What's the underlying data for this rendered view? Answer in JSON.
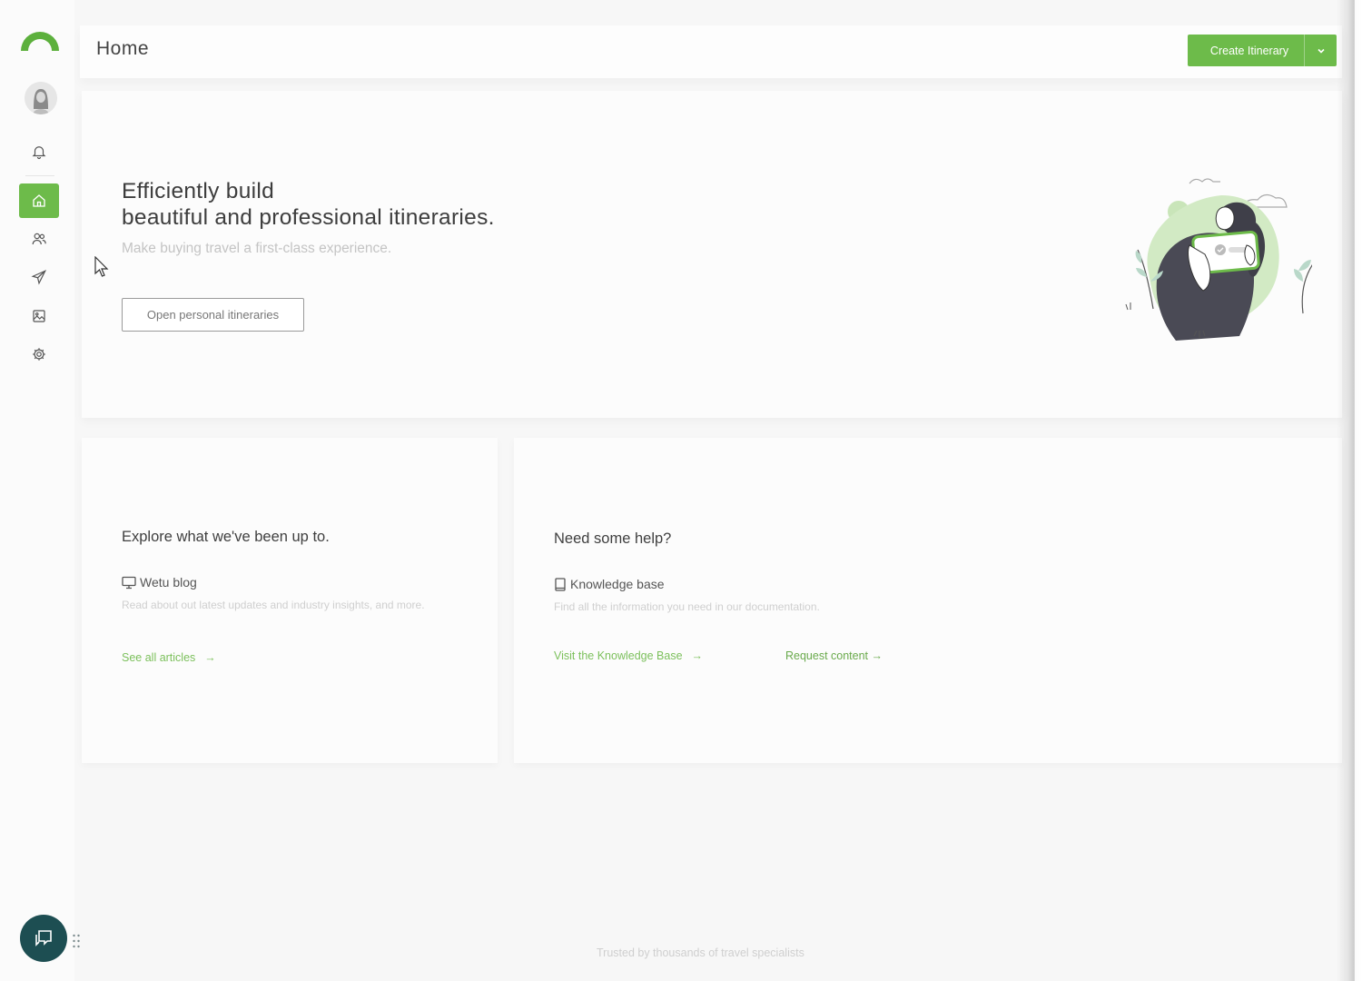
{
  "header": {
    "title": "Home",
    "create_button": "Create Itinerary"
  },
  "sidebar": {
    "items": [
      {
        "name": "notifications",
        "icon": "bell-icon"
      },
      {
        "name": "home",
        "icon": "home-icon",
        "active": true
      },
      {
        "name": "contacts",
        "icon": "users-icon"
      },
      {
        "name": "send",
        "icon": "paper-plane-icon"
      },
      {
        "name": "media",
        "icon": "image-icon"
      },
      {
        "name": "settings",
        "icon": "gear-icon"
      }
    ],
    "accent": "#6dbb4a"
  },
  "hero": {
    "title_line1": "Efficiently build",
    "title_line2": "beautiful and professional itineraries.",
    "subtitle": "Make buying travel a first-class experience.",
    "button": "Open personal itineraries"
  },
  "blog_card": {
    "heading": "Explore what we've been up to.",
    "link_title": "Wetu blog",
    "description": "Read about out latest updates and industry insights, and more.",
    "link": "See all articles",
    "link_arrow": "→"
  },
  "help_card": {
    "heading": "Need some help?",
    "link_title": "Knowledge base",
    "description": "Find all the information you need in our documentation.",
    "link1": "Visit the Knowledge Base",
    "link1_arrow": "→",
    "link2": "Request content →"
  },
  "footer": {
    "text": "Trusted by thousands of travel specialists"
  }
}
